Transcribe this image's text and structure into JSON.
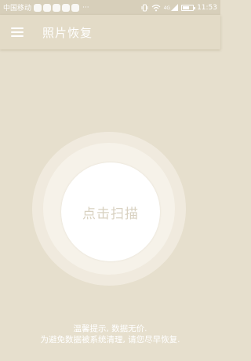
{
  "status_bar": {
    "carrier": "中国移动",
    "more": "···",
    "network": "4G",
    "time": "11:53"
  },
  "app_bar": {
    "title": "照片恢复"
  },
  "scan_button": {
    "label": "点击扫描"
  },
  "hint": {
    "line1": "温馨提示, 数据无价.",
    "line2": "为避免数据被系统清理, 请您尽早恢复."
  },
  "colors": {
    "background": "#e6dfcd",
    "status_bar": "#d7cfba",
    "app_bar": "#e3dbc7",
    "scan_text": "#d8d1c0"
  },
  "icons": [
    "menu-icon",
    "vibrate-icon",
    "wifi-icon",
    "signal-icon",
    "battery-icon"
  ]
}
